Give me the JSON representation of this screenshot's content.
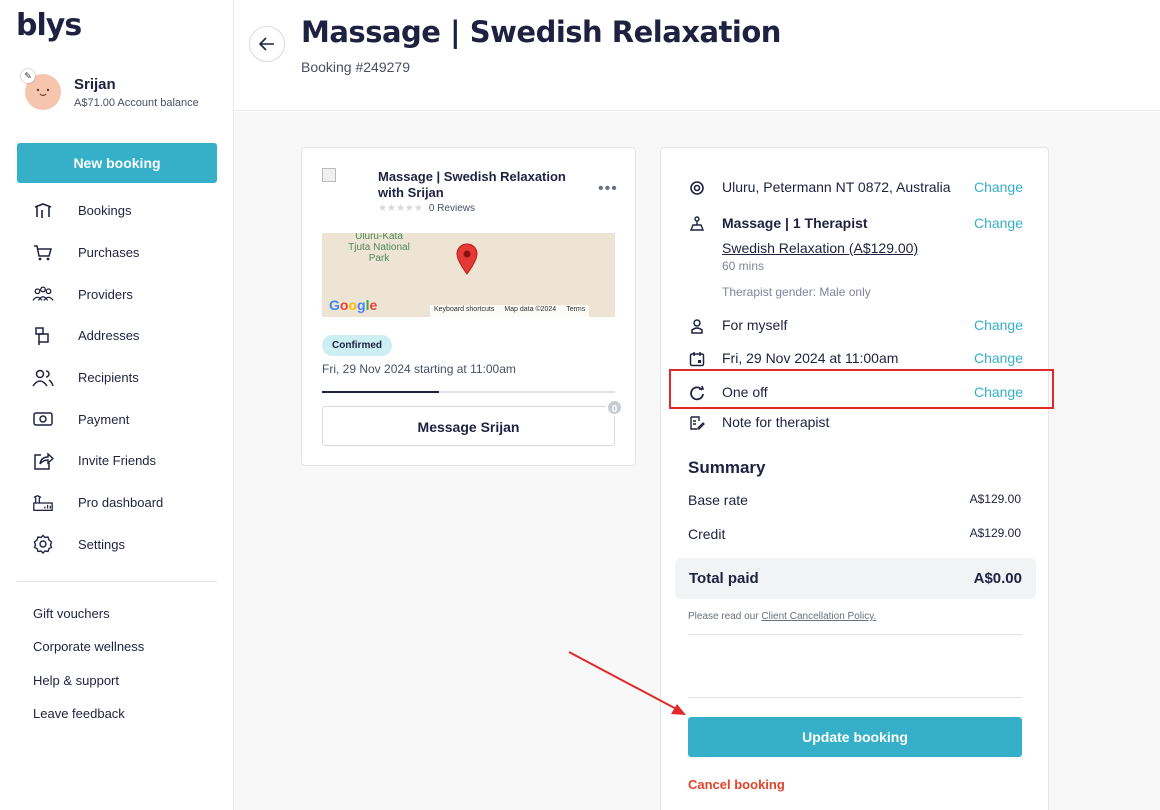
{
  "brand": {
    "logo": "blys",
    "accent": "#35b0c8"
  },
  "user": {
    "name": "Srijan",
    "balance": "A$71.00 Account balance"
  },
  "sidebar": {
    "new_booking": "New booking",
    "items": [
      {
        "label": "Bookings",
        "icon": "bookings-icon"
      },
      {
        "label": "Purchases",
        "icon": "cart-icon"
      },
      {
        "label": "Providers",
        "icon": "providers-icon"
      },
      {
        "label": "Addresses",
        "icon": "address-icon"
      },
      {
        "label": "Recipients",
        "icon": "recipients-icon"
      },
      {
        "label": "Payment",
        "icon": "payment-icon"
      },
      {
        "label": "Invite Friends",
        "icon": "share-icon"
      },
      {
        "label": "Pro dashboard",
        "icon": "pro-dashboard-icon"
      },
      {
        "label": "Settings",
        "icon": "gear-icon"
      }
    ],
    "footer": [
      "Gift vouchers",
      "Corporate wellness",
      "Help & support",
      "Leave feedback"
    ]
  },
  "header": {
    "title": "Massage | Swedish Relaxation",
    "booking_id": "Booking #249279"
  },
  "provider_card": {
    "title": "Massage | Swedish Relaxation with Srijan",
    "reviews": "0 Reviews",
    "rating": 0,
    "map": {
      "park_label": "Uluru-Kata Tjuta National Park",
      "google": "Google",
      "shortcuts": "Keyboard shortcuts",
      "map_data": "Map data ©2024",
      "terms": "Terms"
    },
    "status": "Confirmed",
    "date": "Fri, 29 Nov 2024 starting at 11:00am",
    "message_button": "Message Srijan",
    "message_count": "0"
  },
  "details": {
    "address": "Uluru, Petermann NT 0872, Australia",
    "change": "Change",
    "service": "Massage | 1 Therapist",
    "service_option": "Swedish Relaxation (A$129.00)",
    "duration": "60 mins",
    "gender": "Therapist gender: Male only",
    "recipient": "For myself",
    "datetime": "Fri, 29 Nov 2024 at 11:00am",
    "frequency": "One off",
    "note": "Note for therapist"
  },
  "summary": {
    "title": "Summary",
    "rows": [
      {
        "label": "Base rate",
        "value": "A$129.00"
      },
      {
        "label": "Credit",
        "value": "A$129.00"
      }
    ],
    "total_label": "Total paid",
    "total_value": "A$0.00",
    "policy_prefix": "Please read our",
    "policy_link": "Client Cancellation Policy."
  },
  "actions": {
    "update": "Update booking",
    "cancel": "Cancel booking"
  }
}
